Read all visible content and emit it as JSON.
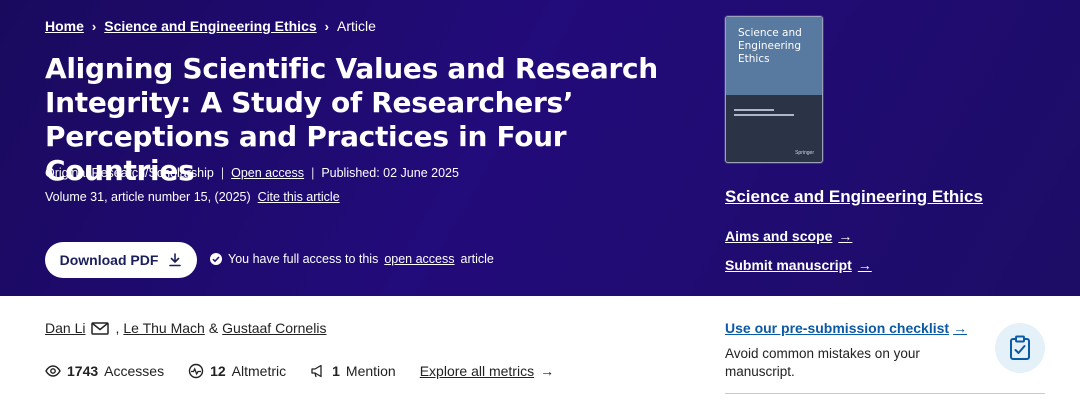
{
  "breadcrumb": {
    "home": "Home",
    "journal": "Science and Engineering Ethics",
    "current": "Article"
  },
  "article": {
    "title": "Aligning Scientific Values and Research Integrity: A Study of Researchers’ Perceptions and Practices in Four Countries",
    "type": "Original Research/Scholarship",
    "access": "Open access",
    "published": "Published: 02 June 2025",
    "volume": "Volume 31, article number 15, (2025)",
    "cite": "Cite this article"
  },
  "download": {
    "label": "Download PDF",
    "note_prefix": "You have full access to this",
    "note_link": "open access",
    "note_suffix": "article"
  },
  "cover": {
    "title_line1": "Science and",
    "title_line2": "Engineering",
    "title_line3": "Ethics",
    "publisher": "Springer"
  },
  "sidebar": {
    "journal": "Science and Engineering Ethics",
    "aims": "Aims and scope",
    "submit": "Submit manuscript",
    "checklist": "Use our pre-submission checklist",
    "checklist_desc": "Avoid common mistakes on your manuscript."
  },
  "authors": {
    "a1": "Dan Li",
    "a2": "Le Thu Mach",
    "amp": "&",
    "a3": "Gustaaf Cornelis"
  },
  "metrics": {
    "accesses_count": "1743",
    "accesses_label": "Accesses",
    "altmetric_count": "12",
    "altmetric_label": "Altmetric",
    "mention_count": "1",
    "mention_label": "Mention",
    "explore": "Explore all metrics"
  },
  "colors": {
    "hero_bg": "#1f0b70",
    "link_blue": "#0b5aa8",
    "cover_blue": "#5879a0"
  }
}
